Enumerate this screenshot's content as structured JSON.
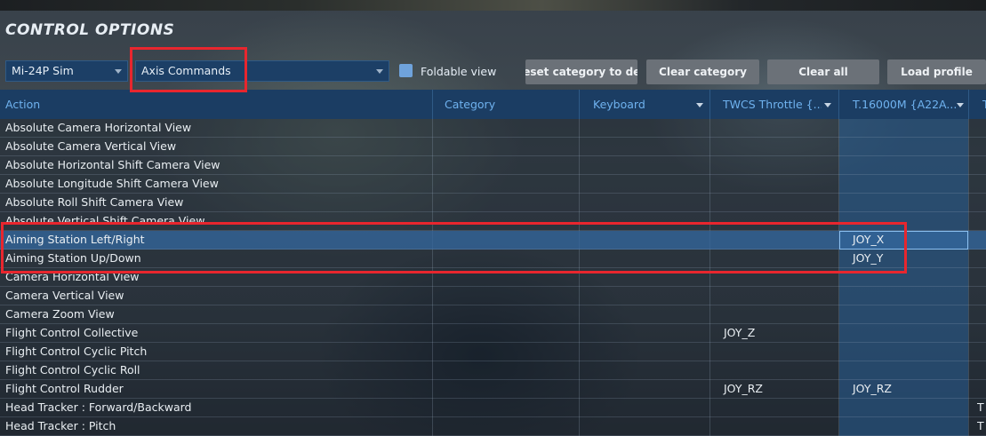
{
  "window": {
    "title": "CONTROL OPTIONS"
  },
  "toolbar": {
    "aircraft_select": "Mi-24P Sim",
    "category_select": "Axis Commands",
    "foldable_label": "Foldable view",
    "foldable_checked": false,
    "reset_category_label": "Reset category to default",
    "clear_category_label": "Clear category",
    "clear_all_label": "Clear all",
    "load_profile_label": "Load profile"
  },
  "columns": {
    "action": "Action",
    "category": "Category",
    "keyboard": "Keyboard",
    "throttle": "TWCS Throttle {...",
    "joystick": "T.16000M {A22A...",
    "extra": "T"
  },
  "rows": [
    {
      "action": "Absolute Camera Horizontal View",
      "throttle": "",
      "joystick": "",
      "extra": ""
    },
    {
      "action": "Absolute Camera Vertical View",
      "throttle": "",
      "joystick": "",
      "extra": ""
    },
    {
      "action": "Absolute Horizontal Shift Camera View",
      "throttle": "",
      "joystick": "",
      "extra": ""
    },
    {
      "action": "Absolute Longitude Shift Camera View",
      "throttle": "",
      "joystick": "",
      "extra": ""
    },
    {
      "action": "Absolute Roll Shift Camera View",
      "throttle": "",
      "joystick": "",
      "extra": ""
    },
    {
      "action": "Absolute Vertical Shift Camera View",
      "throttle": "",
      "joystick": "",
      "extra": ""
    },
    {
      "action": "Aiming Station Left/Right",
      "throttle": "",
      "joystick": "JOY_X",
      "extra": ""
    },
    {
      "action": "Aiming Station Up/Down",
      "throttle": "",
      "joystick": "JOY_Y",
      "extra": ""
    },
    {
      "action": "Camera Horizontal View",
      "throttle": "",
      "joystick": "",
      "extra": ""
    },
    {
      "action": "Camera Vertical View",
      "throttle": "",
      "joystick": "",
      "extra": ""
    },
    {
      "action": "Camera Zoom View",
      "throttle": "",
      "joystick": "",
      "extra": ""
    },
    {
      "action": "Flight Control Collective",
      "throttle": "JOY_Z",
      "joystick": "",
      "extra": ""
    },
    {
      "action": "Flight Control Cyclic Pitch",
      "throttle": "",
      "joystick": "",
      "extra": ""
    },
    {
      "action": "Flight Control Cyclic Roll",
      "throttle": "",
      "joystick": "",
      "extra": ""
    },
    {
      "action": "Flight Control Rudder",
      "throttle": "JOY_RZ",
      "joystick": "JOY_RZ",
      "extra": ""
    },
    {
      "action": "Head Tracker : Forward/Backward",
      "throttle": "",
      "joystick": "",
      "extra": "T"
    },
    {
      "action": "Head Tracker : Pitch",
      "throttle": "",
      "joystick": "",
      "extra": "T"
    }
  ],
  "colors": {
    "highlight_annotation": "#e8262e",
    "header_text": "#6fb2ef",
    "selected_row": "#3468a0"
  }
}
